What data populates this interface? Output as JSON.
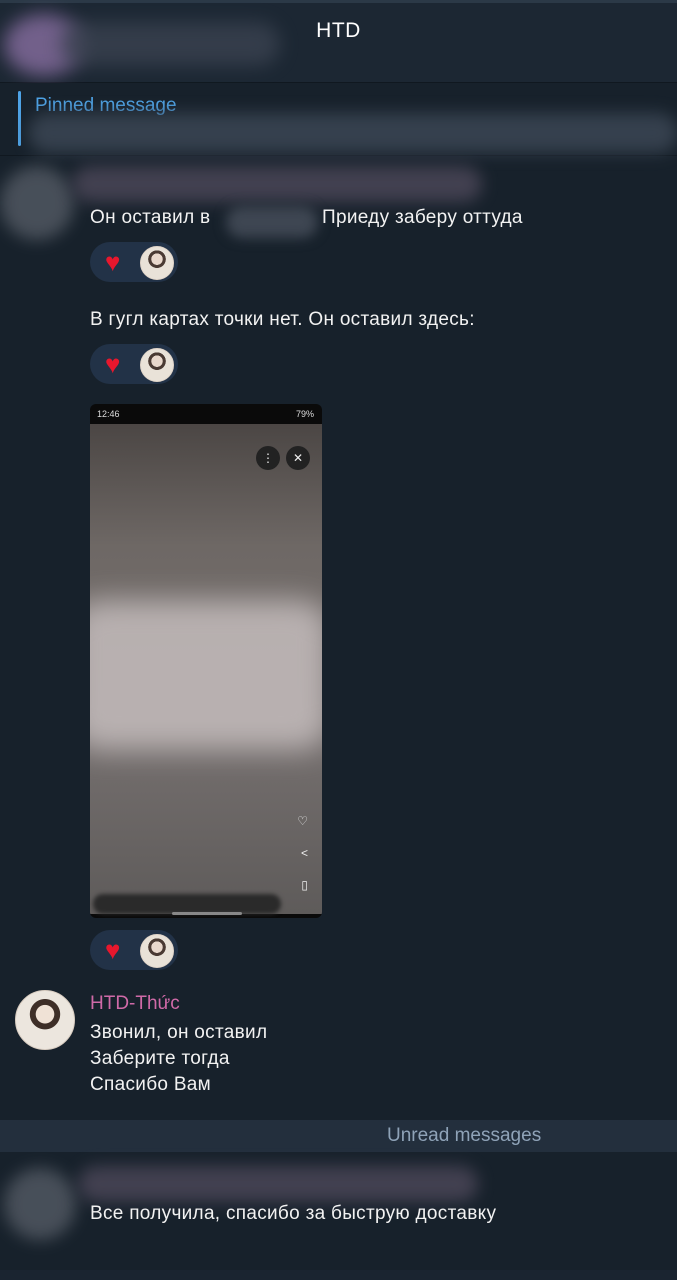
{
  "header": {
    "title": "HTD"
  },
  "pinned": {
    "label": "Pinned message"
  },
  "messages": {
    "m1_part1": "Он оставил в",
    "m1_part2": "Приеду заберу оттуда",
    "m2": "В гугл картах точки нет. Он оставил здесь:",
    "photo": {
      "status_time": "12:46",
      "status_battery": "79%"
    },
    "reaction_emoji": "♥",
    "named_sender": "HTD-Thức",
    "named_lines": [
      "Звонил, он оставил",
      "Заберите тогда",
      "Спасибо Вам"
    ],
    "unread_label": "Unread messages",
    "last": "Все получила, спасибо за быструю доставку"
  },
  "colors": {
    "background": "#17212b",
    "accent": "#4ea3e6",
    "sender_name": "#d06aa8",
    "reaction_bg": "#223247",
    "heart": "#e8172d"
  },
  "icons": [
    "heart-icon",
    "more-vert-icon",
    "close-icon",
    "share-icon",
    "bookmark-icon"
  ]
}
